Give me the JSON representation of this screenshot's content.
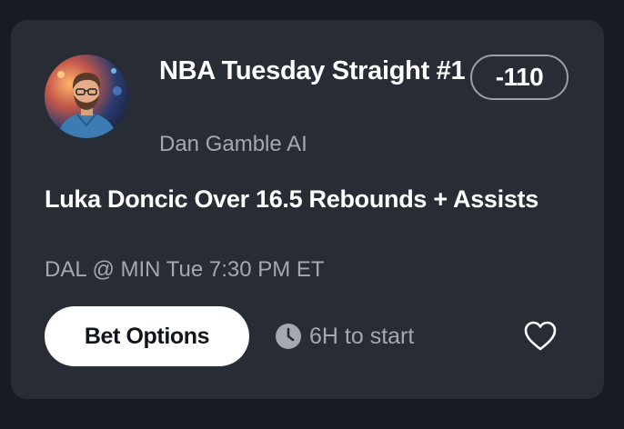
{
  "card": {
    "title": "NBA Tuesday Straight #1",
    "author": "Dan Gamble AI",
    "odds": "-110",
    "pick": "Luka Doncic Over 16.5 Rebounds + Assists",
    "game": "DAL @ MIN Tue 7:30 PM ET",
    "bet_button_label": "Bet Options",
    "start_text": "6H to start",
    "icons": {
      "avatar": "avatar-photo",
      "clock": "clock-icon",
      "favorite": "heart-icon"
    }
  },
  "colors": {
    "background": "#181b21",
    "card": "#272c35",
    "text_primary": "#ffffff",
    "text_secondary": "#a4a9b1",
    "button_bg": "#ffffff"
  }
}
